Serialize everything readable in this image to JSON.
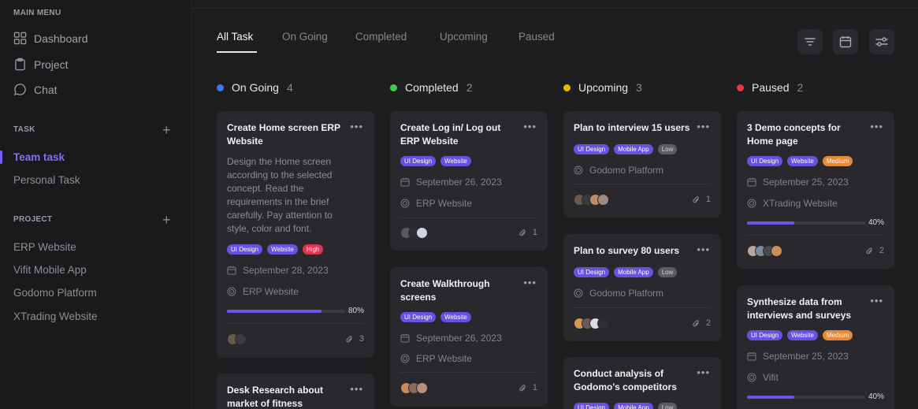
{
  "sidebar": {
    "main_menu_title": "MAIN MENU",
    "main_menu": [
      {
        "label": "Dashboard",
        "icon": "grid-icon"
      },
      {
        "label": "Project",
        "icon": "clipboard-icon"
      },
      {
        "label": "Chat",
        "icon": "chat-icon"
      }
    ],
    "task_title": "TASK",
    "task_items": [
      "Team task",
      "Personal Task"
    ],
    "project_title": "PROJECT",
    "project_items": [
      "ERP Website",
      "Vifit Mobile App",
      "Godomo Platform",
      "XTrading Website"
    ],
    "add_symbol": "+"
  },
  "tabs": [
    "All Task",
    "On Going",
    "Completed",
    "Upcoming",
    "Paused"
  ],
  "columns": [
    {
      "label": "On Going",
      "count": "4",
      "color": "#3b7bf0"
    },
    {
      "label": "Completed",
      "count": "2",
      "color": "#3ecf4a"
    },
    {
      "label": "Upcoming",
      "count": "3",
      "color": "#f4b400"
    },
    {
      "label": "Paused",
      "count": "2",
      "color": "#e8344a"
    }
  ],
  "cards": {
    "c1": {
      "title": "Create Home screen ERP Website",
      "desc": "Design the Home screen according to the selected concept. Read the requirements in the brief carefully. Pay attention to style, color and font.",
      "tags": [
        "UI Design",
        "Website",
        "High"
      ],
      "date": "September 28, 2023",
      "project": "ERP Website",
      "progress": 0.8,
      "pct": "80%",
      "attach": "3"
    },
    "c2": {
      "title": "Desk Research about market of fitness"
    },
    "c3": {
      "title": "Create Log in/ Log out ERP Website",
      "tags": [
        "UI Design",
        "Website"
      ],
      "date": "September 26, 2023",
      "project": "ERP Website",
      "attach": "1"
    },
    "c4": {
      "title": "Create Walkthrough screens",
      "tags": [
        "UI Design",
        "Website"
      ],
      "date": "September 26, 2023",
      "project": "ERP Website",
      "attach": "1"
    },
    "c5": {
      "title": "Plan to interview 15 users",
      "tags": [
        "UI Design",
        "Mobile App",
        "Low"
      ],
      "project": "Godomo Platform",
      "attach": "1"
    },
    "c6": {
      "title": "Plan to survey 80 users",
      "tags": [
        "UI Design",
        "Mobile App",
        "Low"
      ],
      "project": "Godomo Platform",
      "attach": "2"
    },
    "c7": {
      "title": "Conduct analysis of Godomo's competitors",
      "tags": [
        "UI Design",
        "Mobile App",
        "Low"
      ]
    },
    "c8": {
      "title": "3 Demo concepts for Home page",
      "tags": [
        "UI Design",
        "Website",
        "Medium"
      ],
      "date": "September 25, 2023",
      "project": "XTrading Website",
      "progress": 0.4,
      "pct": "40%",
      "attach": "2"
    },
    "c9": {
      "title": "Synthesize data from interviews and surveys",
      "tags": [
        "UI Design",
        "Website",
        "Medium"
      ],
      "date": "September 25, 2023",
      "project": "Vifit",
      "progress": 0.4,
      "pct": "40%"
    }
  },
  "more_symbol": "•••"
}
